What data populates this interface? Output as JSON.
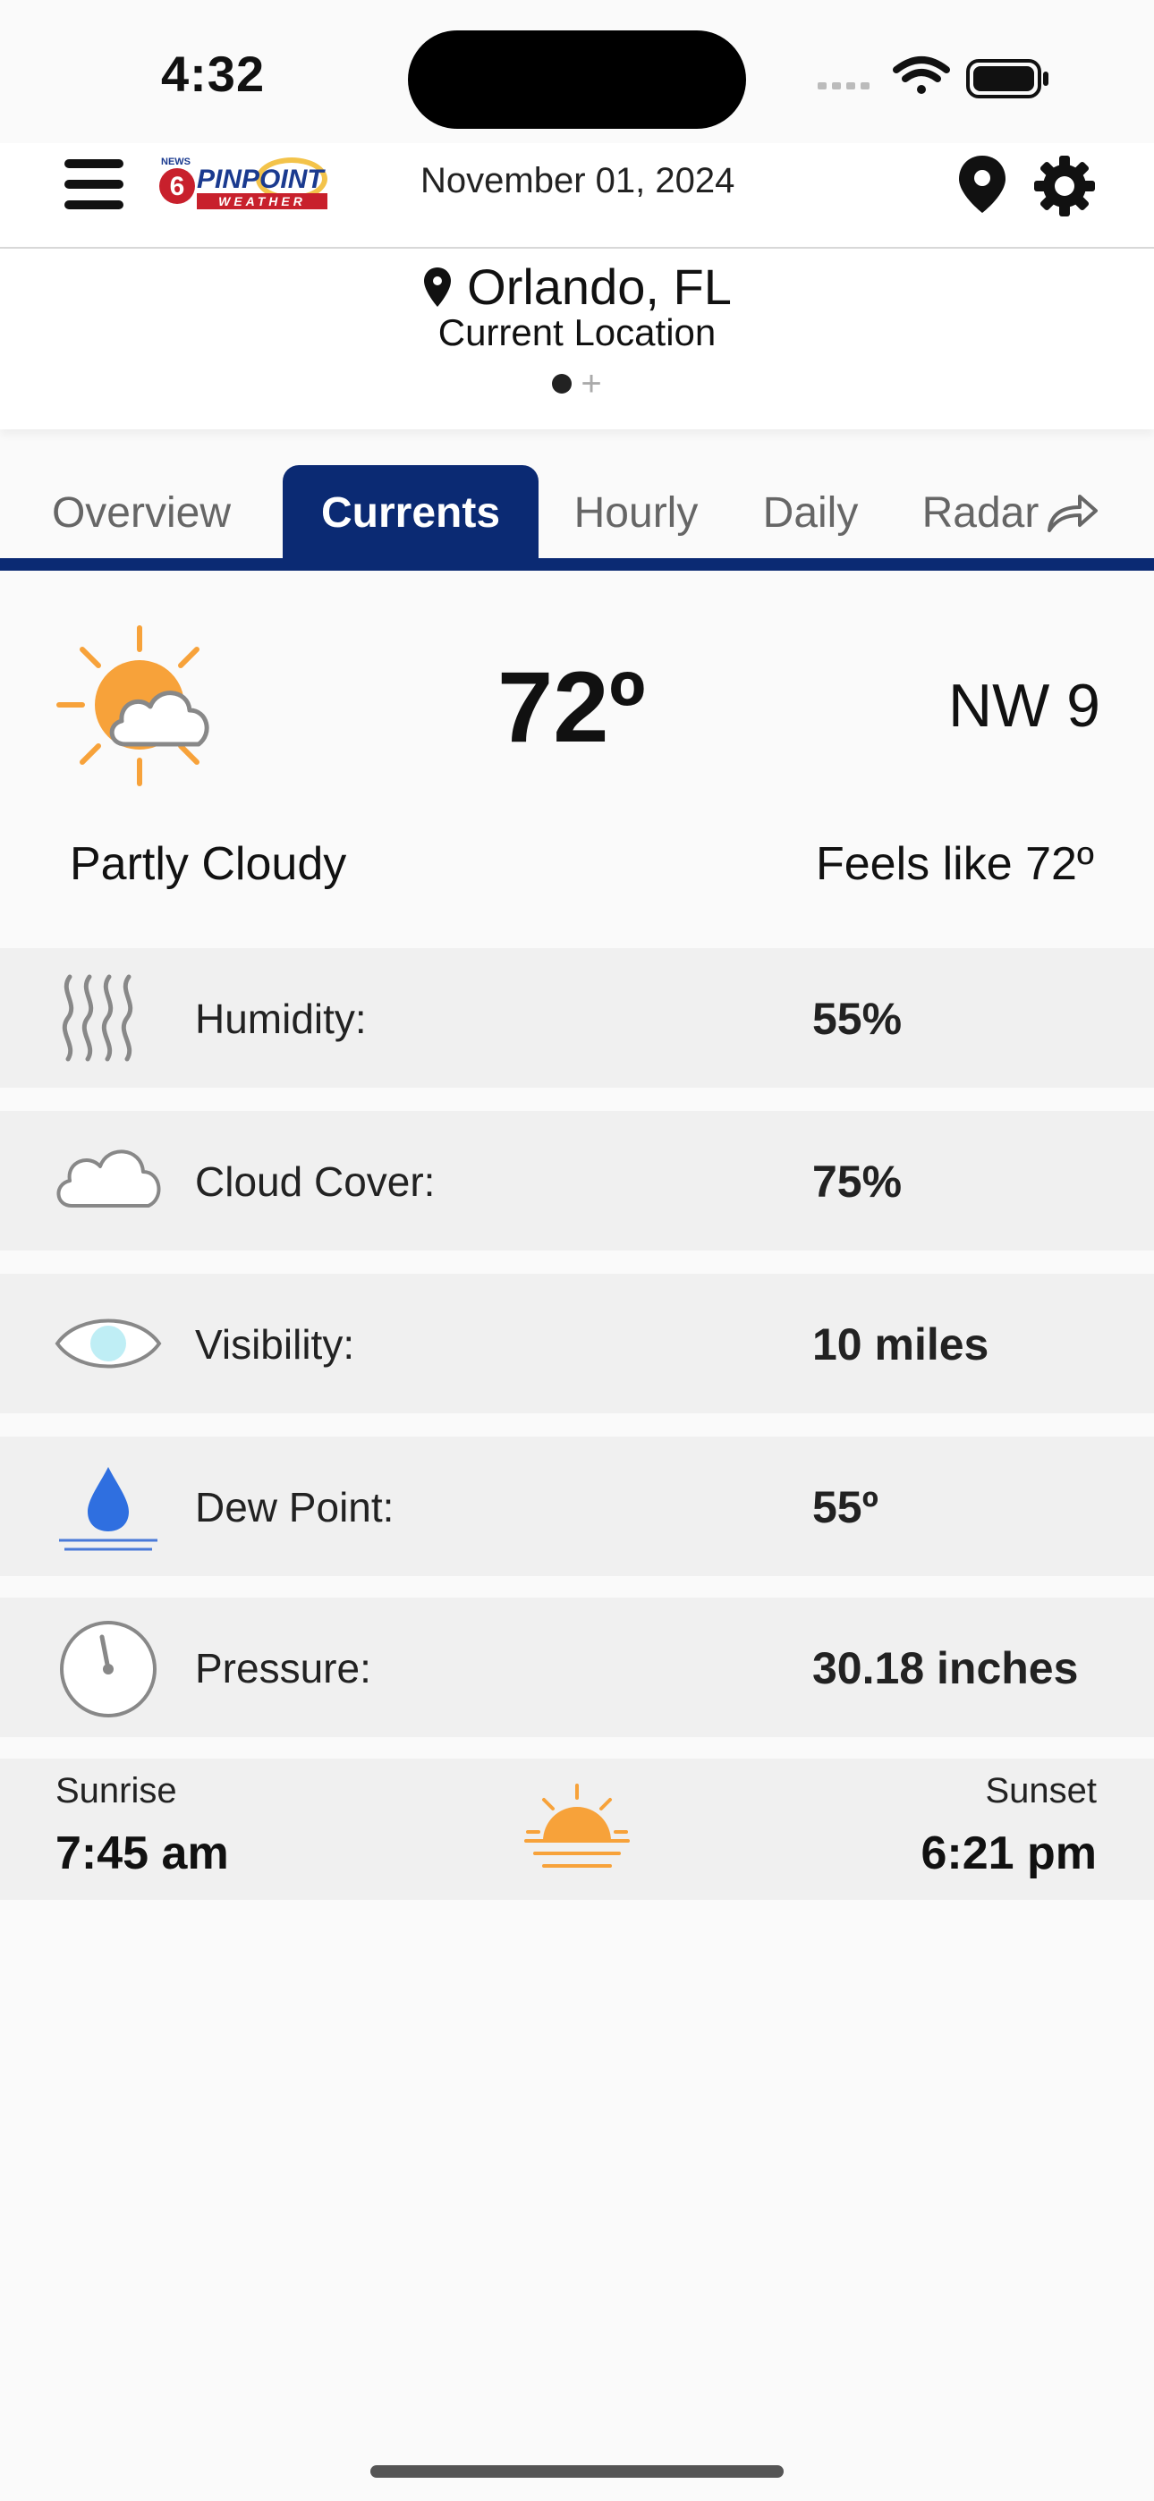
{
  "status": {
    "time": "4:32"
  },
  "header": {
    "logo_text": "NEWS 6 PINPOINT WEATHER",
    "date": "November 01, 2024"
  },
  "location": {
    "city": "Orlando, FL",
    "subtitle": "Current Location"
  },
  "tabs": [
    {
      "label": "Overview"
    },
    {
      "label": "Currents"
    },
    {
      "label": "Hourly"
    },
    {
      "label": "Daily"
    },
    {
      "label": "Radar"
    }
  ],
  "current": {
    "temperature": "72º",
    "wind": "NW 9",
    "condition": "Partly Cloudy",
    "feels_like": "Feels like 72º",
    "icon": "partly-cloudy-icon"
  },
  "details": [
    {
      "label": "Humidity:",
      "value": "55%",
      "icon": "humidity-icon"
    },
    {
      "label": "Cloud Cover:",
      "value": "75%",
      "icon": "cloud-icon"
    },
    {
      "label": "Visibility:",
      "value": "10 miles",
      "icon": "eye-icon"
    },
    {
      "label": "Dew Point:",
      "value": "55º",
      "icon": "dew-drop-icon"
    },
    {
      "label": "Pressure:",
      "value": "30.18 inches",
      "icon": "gauge-icon"
    }
  ],
  "sun": {
    "sunrise_label": "Sunrise",
    "sunrise_time": "7:45 am",
    "sunset_label": "Sunset",
    "sunset_time": "6:21 pm"
  },
  "colors": {
    "accent": "#0b2a73",
    "sun": "#f7a23a",
    "row_bg": "#f0f0f0"
  }
}
